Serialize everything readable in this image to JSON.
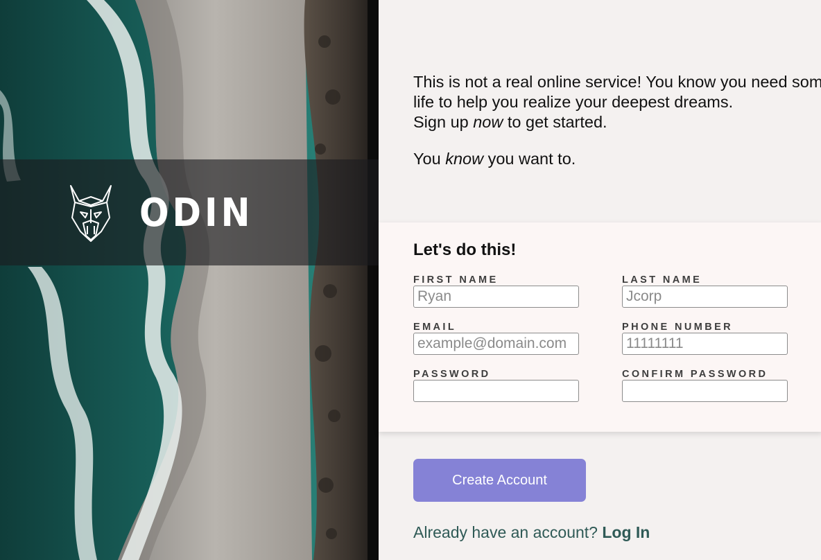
{
  "hero": {
    "brand_name": "ODIN",
    "logo_icon": "viking-helmet-logo-icon"
  },
  "intro": {
    "line1": "This is not a real online service! You know you need something like this in your",
    "line2": "life to help you realize your deepest dreams.",
    "line3_before": "Sign up ",
    "line3_emphasis": "now",
    "line3_after": " to get started.",
    "line4_before": "You ",
    "line4_emphasis": "know",
    "line4_after": " you want to."
  },
  "form": {
    "title": "Let's do this!",
    "fields": {
      "first_name": {
        "label": "FIRST NAME",
        "placeholder": "Ryan",
        "value": ""
      },
      "last_name": {
        "label": "LAST NAME",
        "placeholder": "Jcorp",
        "value": ""
      },
      "email": {
        "label": "EMAIL",
        "placeholder": "example@domain.com",
        "value": ""
      },
      "phone": {
        "label": "PHONE NUMBER",
        "placeholder": "11111111",
        "value": ""
      },
      "password": {
        "label": "PASSWORD",
        "placeholder": "",
        "value": ""
      },
      "confirm_password": {
        "label": "CONFIRM PASSWORD",
        "placeholder": "",
        "value": ""
      }
    }
  },
  "actions": {
    "create_account_label": "Create Account",
    "login_prompt": "Already have an account?",
    "login_link_label": "Log In"
  },
  "colors": {
    "page_background": "#f4f1f0",
    "form_background": "#fcf6f5",
    "button": "#8582d6",
    "link_text": "#2f5a56",
    "hero_band": "#1c1c1e"
  }
}
